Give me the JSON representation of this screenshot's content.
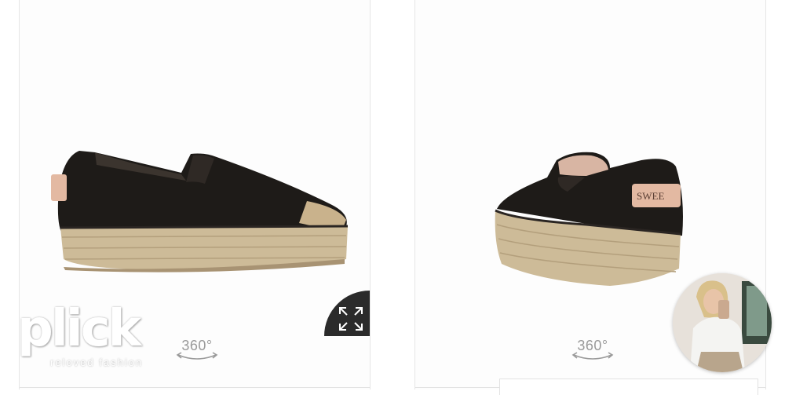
{
  "gallery": {
    "left_view": {
      "alt": "Black leather espadrille, side view",
      "rotate_label": "360°"
    },
    "right_view": {
      "alt": "Black leather espadrille, rear view",
      "rotate_label": "360°",
      "heel_tab_text": "SWEE"
    },
    "expand_icon": "expand-arrows-icon"
  },
  "brand": {
    "logo_word": "plick",
    "tagline": "reloved fashion"
  },
  "video_bubble": {
    "icon": "selfie-video-thumbnail"
  },
  "colors": {
    "shoe_leather": "#1e1b18",
    "jute_sole": "#cdbb98",
    "heel_tab": "#e3b9a2",
    "expand_bg": "#2b2b2b"
  }
}
